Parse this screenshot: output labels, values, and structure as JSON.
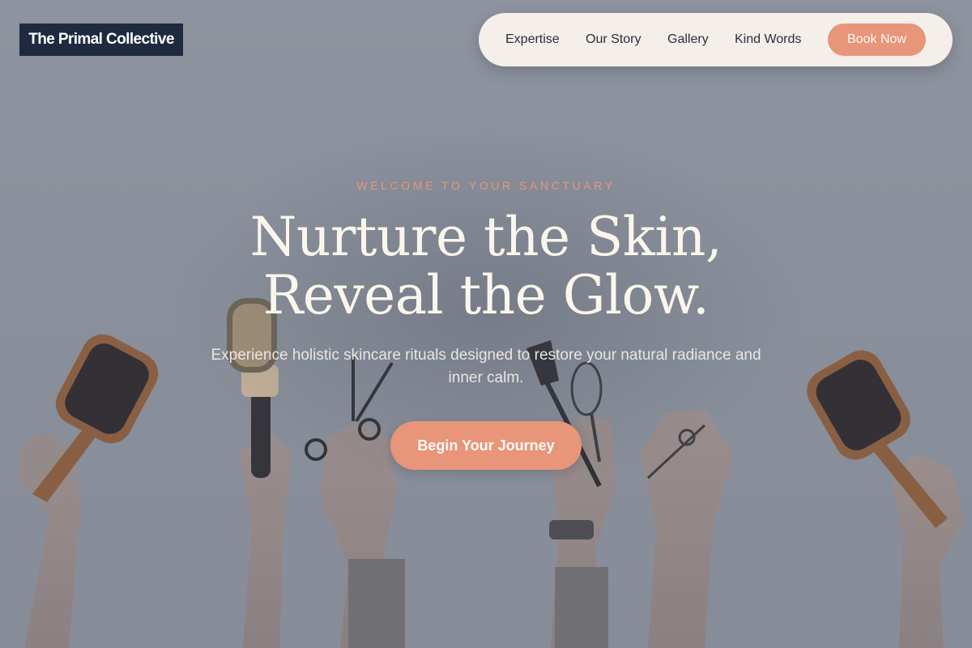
{
  "brand": {
    "logo_text": "The Primal Collective"
  },
  "nav": {
    "links": [
      {
        "label": "Expertise"
      },
      {
        "label": "Our Story"
      },
      {
        "label": "Gallery"
      },
      {
        "label": "Kind Words"
      }
    ],
    "cta_label": "Book Now"
  },
  "hero": {
    "eyebrow": "WELCOME TO YOUR SANCTUARY",
    "headline_line1": "Nurture the Skin,",
    "headline_line2": "Reveal the Glow.",
    "subtext": "Experience holistic skincare rituals designed to restore your natural radiance and inner calm.",
    "cta_label": "Begin Your Journey",
    "background_image": "hands-holding-salon-tools"
  },
  "colors": {
    "accent": "#e8957a",
    "logo_bg": "#1f2a3f",
    "nav_bg": "#f4efe8",
    "headline": "#fbf6ec"
  }
}
